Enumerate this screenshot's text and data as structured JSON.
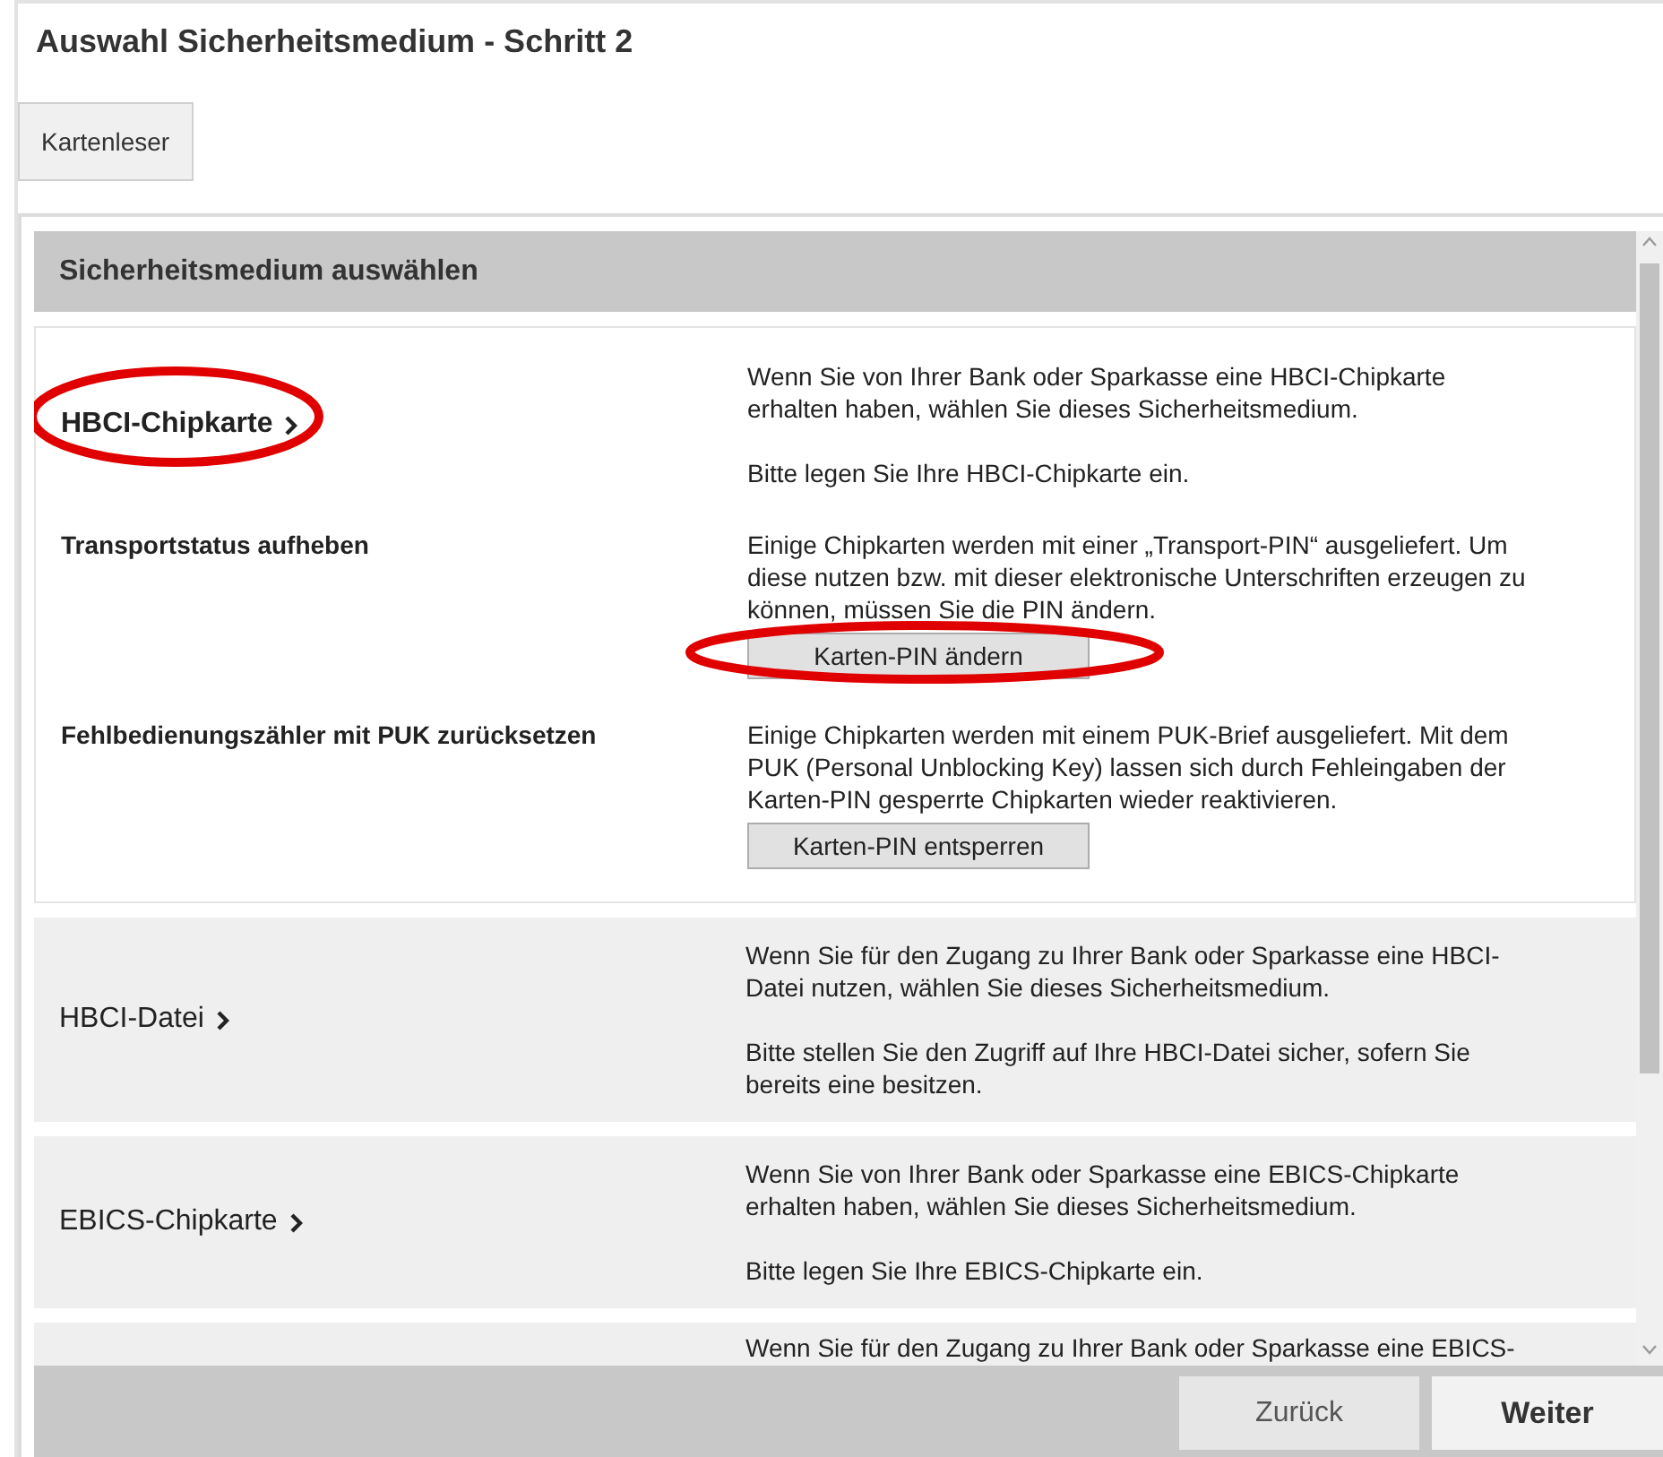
{
  "window": {
    "title": "Auswahl Sicherheitsmedium - Schritt 2"
  },
  "toolbar": {
    "buttons": [
      {
        "label": "Kartenleser"
      }
    ]
  },
  "panel": {
    "title": "Sicherheitsmedium auswählen",
    "media": [
      {
        "name": "HBCI-Chipkarte",
        "expanded": true,
        "highlighted": true,
        "description": [
          "Wenn Sie von Ihrer Bank oder Sparkasse eine HBCI-Chipkarte erhalten haben, wählen Sie dieses Sicherheitsmedium.",
          "Bitte legen Sie Ihre HBCI-Chipkarte ein."
        ],
        "actions": [
          {
            "title": "Transportstatus aufheben",
            "text": "Einige Chipkarten werden mit einer „Transport-PIN“ ausgeliefert. Um diese nutzen bzw. mit dieser elektronische Unterschriften erzeugen zu können, müssen Sie die PIN ändern.",
            "button": "Karten-PIN ändern",
            "highlighted": true
          },
          {
            "title": "Fehlbedienungszähler mit PUK zurücksetzen",
            "text": "Einige Chipkarten werden mit einem PUK-Brief ausgeliefert. Mit dem PUK (Personal Unblocking Key) lassen sich durch Fehleingaben der Karten-PIN gesperrte Chipkarten wieder reaktivieren.",
            "button": "Karten-PIN entsperren",
            "highlighted": false
          }
        ]
      },
      {
        "name": "HBCI-Datei",
        "expanded": false,
        "highlighted": false,
        "description": [
          "Wenn Sie für den Zugang zu Ihrer Bank oder Sparkasse eine HBCI-Datei nutzen, wählen Sie dieses Sicherheitsmedium.",
          "Bitte stellen Sie den Zugriff auf Ihre HBCI-Datei sicher, sofern Sie bereits eine besitzen."
        ]
      },
      {
        "name": "EBICS-Chipkarte",
        "expanded": false,
        "highlighted": false,
        "description": [
          "Wenn Sie von Ihrer Bank oder Sparkasse eine EBICS-Chipkarte erhalten haben, wählen Sie dieses Sicherheitsmedium.",
          "Bitte legen Sie Ihre EBICS-Chipkarte ein."
        ]
      },
      {
        "expanded": false,
        "highlighted": false,
        "description": [
          "Wenn Sie für den Zugang zu Ihrer Bank oder Sparkasse eine EBICS-"
        ]
      }
    ]
  },
  "footer": {
    "buttons": [
      {
        "label": "Zurück",
        "kind": "secondary"
      },
      {
        "label": "Weiter",
        "kind": "primary"
      }
    ]
  }
}
